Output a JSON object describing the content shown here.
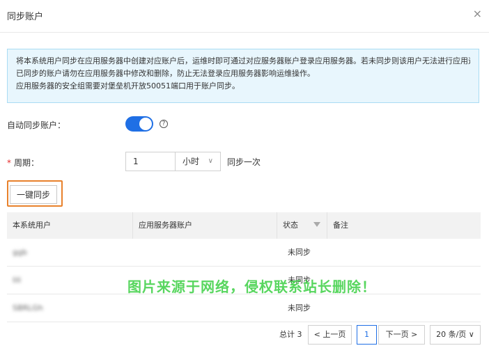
{
  "dialog": {
    "title": "同步账户",
    "close_icon": "×"
  },
  "info_lines": [
    "将本系统用户同步在应用服务器中创建对应账户后，运维时即可通过对应服务器账户登录应用服务器。若未同步则该用户无法进行应用运维。",
    "已同步的账户请勿在应用服务器中修改和删除，防止无法登录应用服务器影响运维操作。",
    "应用服务器的安全组需要对堡垒机开放50051端口用于账户同步。"
  ],
  "auto_sync": {
    "label": "自动同步账户：",
    "enabled": true,
    "help_icon": "?"
  },
  "period": {
    "required_mark": "*",
    "label": "周期：",
    "value": "1",
    "unit": "小时",
    "suffix": "同步一次"
  },
  "sync_button": "一键同步",
  "table": {
    "headers": [
      "本系统用户",
      "应用服务器账户",
      "状态",
      "备注"
    ],
    "rows": [
      {
        "user": "ggb",
        "account": "",
        "status": "未同步",
        "note": ""
      },
      {
        "user": "lili",
        "account": "",
        "status": "未同步",
        "note": ""
      },
      {
        "user": "SBRLGh",
        "account": "",
        "status": "未同步",
        "note": ""
      }
    ]
  },
  "pagination": {
    "total": "总计 3",
    "prev": "上一页",
    "page": "1",
    "next": "下一页",
    "page_size": "20 条/页"
  },
  "watermark": "图片来源于网络，侵权联系站长删除！",
  "colors": {
    "accent": "#1f6fe5",
    "highlight": "#e8812b",
    "info_bg": "#e8f6fd",
    "watermark": "#3ccf44"
  }
}
